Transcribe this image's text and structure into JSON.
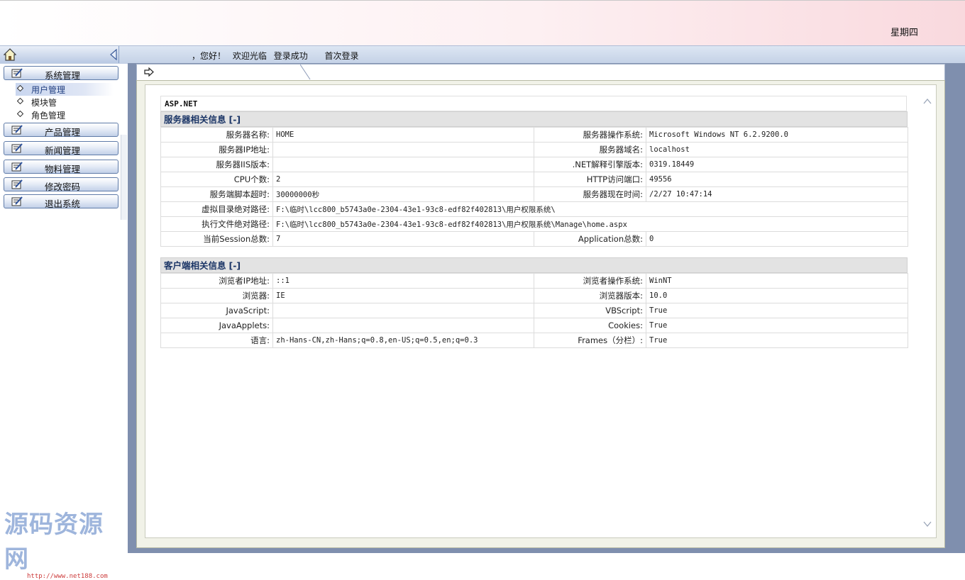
{
  "header": {
    "weekday": "星期四"
  },
  "welcome": {
    "greeting": "，您好！",
    "welcome_msg": "欢迎光临",
    "login_status": "登录成功",
    "first_login": "首次登录"
  },
  "sidebar": {
    "menus": [
      {
        "label": "系统管理",
        "icon": "edit-note-icon"
      },
      {
        "label": "产品管理",
        "icon": "edit-note-icon"
      },
      {
        "label": "新闻管理",
        "icon": "edit-note-icon"
      },
      {
        "label": "物料管理",
        "icon": "edit-note-icon"
      },
      {
        "label": "修改密码",
        "icon": "edit-note-icon"
      },
      {
        "label": "退出系统",
        "icon": "edit-note-icon"
      }
    ],
    "sub_items": [
      {
        "label": "用户管理",
        "active": true
      },
      {
        "label": "模块管"
      },
      {
        "label": "角色管理"
      }
    ]
  },
  "watermark": {
    "title": "源码资源网",
    "url": "http://www.net188.com"
  },
  "content": {
    "banner": "ASP.NET",
    "server": {
      "title": "服务器相关信息",
      "toggle": "[-]",
      "rows": [
        {
          "l1": "服务器名称:",
          "v1": "HOME",
          "l2": "服务器操作系统:",
          "v2": "Microsoft Windows NT 6.2.9200.0"
        },
        {
          "l1": "服务器IP地址:",
          "v1": "",
          "l2": "服务器域名:",
          "v2": "localhost"
        },
        {
          "l1": "服务器IIS版本:",
          "v1": "",
          "l2": ".NET解释引擎版本:",
          "v2": "0319.18449"
        },
        {
          "l1": "CPU个数:",
          "v1": "2",
          "l2": "HTTP访问端口:",
          "v2": "49556"
        },
        {
          "l1": "服务端脚本超时:",
          "v1": "30000000秒",
          "l2": "服务器现在时间:",
          "v2": "/2/27 10:47:14"
        }
      ],
      "wide_rows": [
        {
          "l": "虚拟目录绝对路径:",
          "v": "F:\\临时\\lcc800_b5743a0e-2304-43e1-93c8-edf82f402813\\用户权限系统\\"
        },
        {
          "l": "执行文件绝对路径:",
          "v": "F:\\临时\\lcc800_b5743a0e-2304-43e1-93c8-edf82f402813\\用户权限系统\\Manage\\home.aspx"
        }
      ],
      "last_row": {
        "l1": "当前Session总数:",
        "v1": "7",
        "l2": "Application总数:",
        "v2": "0"
      }
    },
    "client": {
      "title": "客户端相关信息",
      "toggle": "[-]",
      "rows": [
        {
          "l1": "浏览者IP地址:",
          "v1": "::1",
          "l2": "浏览者操作系统:",
          "v2": "WinNT"
        },
        {
          "l1": "浏览器:",
          "v1": "IE",
          "l2": "浏览器版本:",
          "v2": "10.0"
        },
        {
          "l1": "JavaScript:",
          "v1": "",
          "l2": "VBScript:",
          "v2": "True"
        },
        {
          "l1": "JavaApplets:",
          "v1": "",
          "l2": "Cookies:",
          "v2": "True"
        },
        {
          "l1": "语言:",
          "v1": "zh-Hans-CN,zh-Hans;q=0.8,en-US;q=0.5,en;q=0.3",
          "l2": "Frames（分栏）:",
          "v2": "True"
        }
      ]
    }
  }
}
